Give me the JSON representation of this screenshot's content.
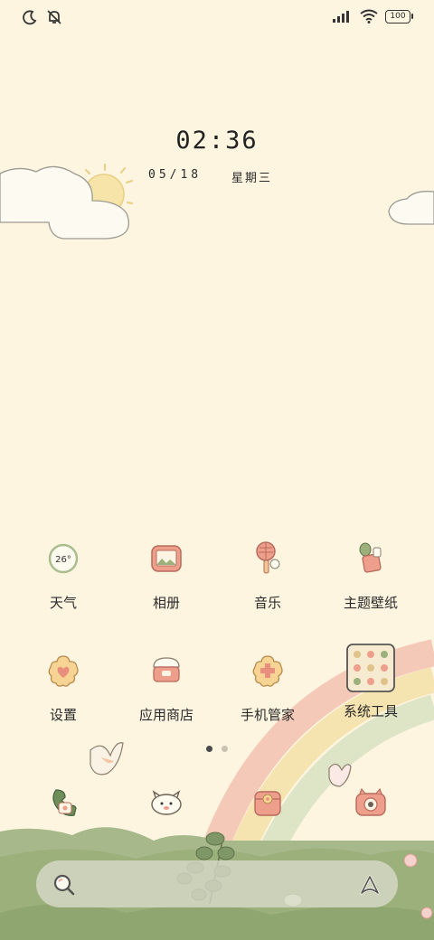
{
  "status_bar": {
    "battery": "100",
    "icons": [
      "moon-icon",
      "mute-bell-icon",
      "signal-icon",
      "wifi-icon",
      "battery-icon"
    ]
  },
  "lock": {
    "time": "02:36",
    "date": "05/18",
    "weekday": "星期三"
  },
  "apps_row1": [
    {
      "label": "天气",
      "icon": "weather-icon",
      "temp": "26°"
    },
    {
      "label": "相册",
      "icon": "gallery-icon"
    },
    {
      "label": "音乐",
      "icon": "music-icon"
    },
    {
      "label": "主题壁纸",
      "icon": "theme-icon"
    }
  ],
  "apps_row2": [
    {
      "label": "设置",
      "icon": "settings-icon"
    },
    {
      "label": "应用商店",
      "icon": "app-store-icon"
    },
    {
      "label": "手机管家",
      "icon": "phone-manager-icon"
    },
    {
      "label": "系统工具",
      "icon": "system-tools-folder-icon"
    }
  ],
  "page_indicator": {
    "pages": 2,
    "current": 1
  },
  "dock_apps": [
    "phone-icon",
    "messages-icon",
    "wallet-icon",
    "camera-icon"
  ],
  "dock_bar": [
    "search-icon",
    "assistant-icon"
  ],
  "colors": {
    "background": "#fdf5e0",
    "hill_green": "#9cb07c",
    "rainbow_pink": "#f4c9b8",
    "rainbow_yellow": "#f5e3b0",
    "rainbow_green": "#dde5c6",
    "icon_pink": "#e99a8a"
  }
}
